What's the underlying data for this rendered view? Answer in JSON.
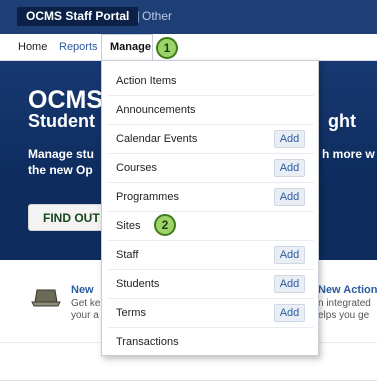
{
  "topbar": {
    "portal_title": "OCMS Staff Portal",
    "separator": "|",
    "other_link": "Other"
  },
  "nav": {
    "home": "Home",
    "reports": "Reports",
    "manage": "Manage"
  },
  "hero": {
    "title": "OCMS",
    "sub_left": "Student r",
    "sub_right": "ght",
    "body_line1": "Manage stu",
    "body_line1_right": "h more w",
    "body_line2": "the new Op",
    "button": "FIND OUT"
  },
  "features": {
    "left_title": "New",
    "left_desc_1": "Get ke",
    "left_desc_2": "your a",
    "right_title": "New Action",
    "right_desc_1": "n integrated",
    "right_desc_2": "elps you ge"
  },
  "manage_menu": {
    "items": [
      {
        "label": "Action Items",
        "add": ""
      },
      {
        "label": "Announcements",
        "add": ""
      },
      {
        "label": "Calendar Events",
        "add": "Add"
      },
      {
        "label": "Courses",
        "add": "Add"
      },
      {
        "label": "Programmes",
        "add": "Add"
      },
      {
        "label": "Sites",
        "add": ""
      },
      {
        "label": "Staff",
        "add": "Add"
      },
      {
        "label": "Students",
        "add": "Add"
      },
      {
        "label": "Terms",
        "add": "Add"
      },
      {
        "label": "Transactions",
        "add": ""
      }
    ]
  },
  "callouts": {
    "one": "1",
    "two": "2"
  },
  "colors": {
    "topbar": "#1d3f75",
    "hero": "#0e2c5e",
    "callout_fill": "#9ed36a",
    "link": "#2c5b9e"
  }
}
